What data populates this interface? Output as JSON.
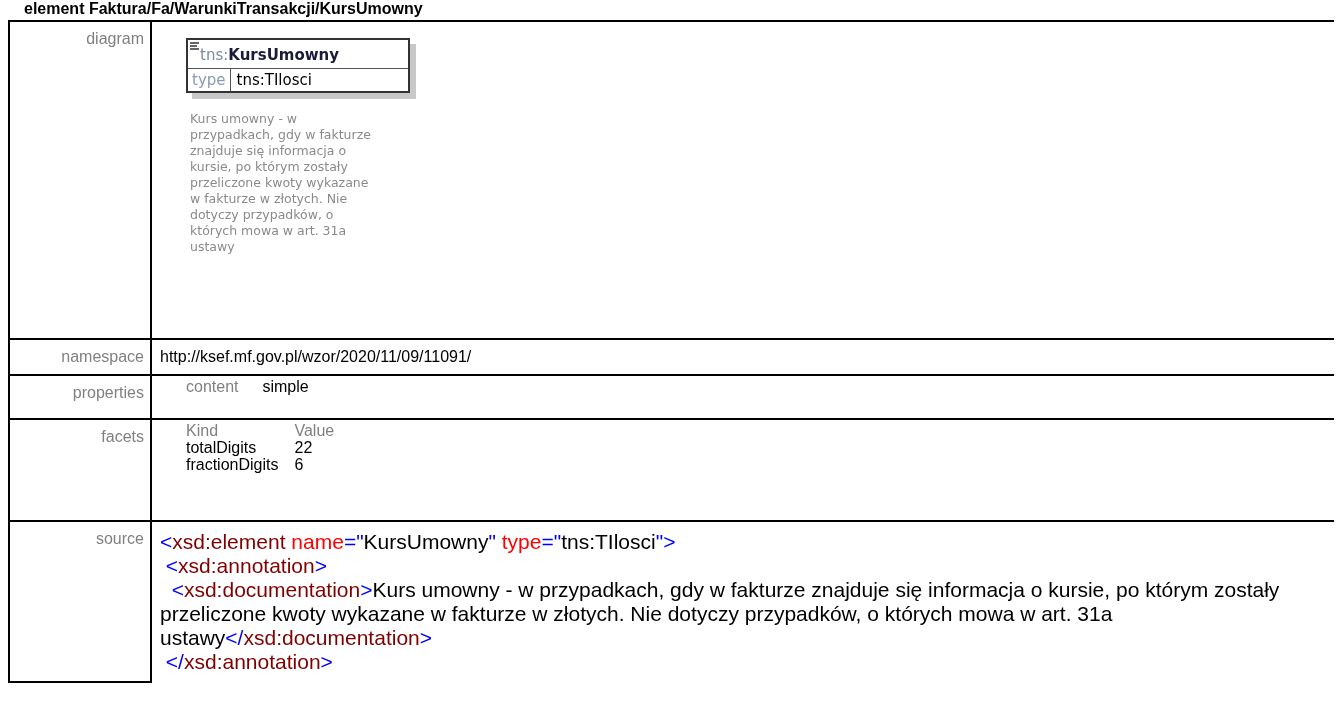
{
  "heading": {
    "kind_label": "element",
    "path": "Faktura/Fa/WarunkiTransakcji/KursUmowny"
  },
  "diagram": {
    "label": "diagram",
    "prefix": "tns:",
    "name": "KursUmowny",
    "type_label": "type",
    "type_value": "tns:TIlosci",
    "documentation": "Kurs umowny - w przypadkach, gdy w fakturze znajduje się informacja o kursie, po którym zostały przeliczone kwoty wykazane w fakturze w złotych. Nie dotyczy przypadków, o których mowa w art. 31a ustawy"
  },
  "namespace": {
    "label": "namespace",
    "value": "http://ksef.mf.gov.pl/wzor/2020/11/09/11091/"
  },
  "properties": {
    "label": "properties",
    "items": [
      {
        "name": "content",
        "value": "simple"
      }
    ]
  },
  "facets": {
    "label": "facets",
    "columns": [
      "Kind",
      "Value"
    ],
    "rows": [
      [
        "totalDigits",
        "22"
      ],
      [
        "fractionDigits",
        "6"
      ]
    ]
  },
  "source": {
    "label": "source",
    "lines": [
      [
        {
          "kind": "punct",
          "text": "<"
        },
        {
          "kind": "tag",
          "text": "xsd:element"
        },
        {
          "kind": "attr",
          "text": " name"
        },
        {
          "kind": "punct",
          "text": "=\""
        },
        {
          "kind": "text",
          "text": "KursUmowny"
        },
        {
          "kind": "punct",
          "text": "\""
        },
        {
          "kind": "attr",
          "text": " type"
        },
        {
          "kind": "punct",
          "text": "=\""
        },
        {
          "kind": "text",
          "text": "tns:TIlosci"
        },
        {
          "kind": "punct",
          "text": "\">"
        }
      ],
      [
        {
          "kind": "punct",
          "text": " <"
        },
        {
          "kind": "tag",
          "text": "xsd:annotation"
        },
        {
          "kind": "punct",
          "text": ">"
        }
      ],
      [
        {
          "kind": "punct",
          "text": "  <"
        },
        {
          "kind": "tag",
          "text": "xsd:documentation"
        },
        {
          "kind": "punct",
          "text": ">"
        },
        {
          "kind": "text",
          "text": "Kurs umowny - w przypadkach, gdy w fakturze znajduje się informacja o kursie, po którym zostały przeliczone kwoty wykazane w fakturze w złotych. Nie dotyczy przypadków, o których mowa w art. 31a ustawy"
        },
        {
          "kind": "punct",
          "text": "</"
        },
        {
          "kind": "tag",
          "text": "xsd:documentation"
        },
        {
          "kind": "punct",
          "text": ">"
        }
      ],
      [
        {
          "kind": "punct",
          "text": " </"
        },
        {
          "kind": "tag",
          "text": "xsd:annotation"
        },
        {
          "kind": "punct",
          "text": ">"
        }
      ]
    ]
  }
}
